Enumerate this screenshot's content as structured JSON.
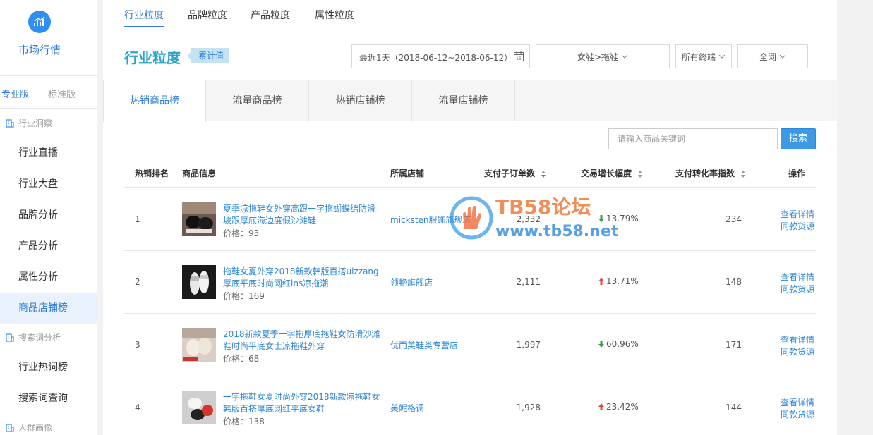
{
  "sidebar": {
    "app_title": "市场行情",
    "version_pro": "专业版",
    "version_std": "标准版",
    "groups": [
      "行业洞察",
      "搜索词分析",
      "人群画像"
    ],
    "items": [
      "行业直播",
      "行业大盘",
      "品牌分析",
      "产品分析",
      "属性分析",
      "商品店铺榜",
      "行业热词榜",
      "搜索词查询"
    ]
  },
  "top_tabs": [
    "行业粒度",
    "品牌粒度",
    "产品粒度",
    "属性粒度"
  ],
  "section": {
    "title": "行业粒度",
    "badge": "累计值"
  },
  "filters": {
    "date": "最近1天（2018-06-12~2018-06-12）",
    "calendar_day": "15",
    "category": "女鞋>拖鞋",
    "terminal": "所有终端",
    "network": "全网"
  },
  "rank_tabs": [
    "热销商品榜",
    "流量商品榜",
    "热销店铺榜",
    "流量店铺榜"
  ],
  "search": {
    "placeholder": "请输入商品关键词",
    "button": "搜索"
  },
  "table": {
    "headers": {
      "rank": "热销排名",
      "product": "商品信息",
      "shop": "所属店铺",
      "orders": "支付子订单数",
      "growth": "交易增长幅度",
      "conversion": "支付转化率指数",
      "action": "操作"
    },
    "rows": [
      {
        "rank": "1",
        "title": "夏季凉拖鞋女外穿高跟一字拖蝴蝶结防滑坡跟厚底海边度假沙滩鞋",
        "price": "价格：93",
        "shop": "micksten服饰旗舰店",
        "orders": "2,332",
        "growth": "13.79%",
        "growth_dir": "down",
        "conv": "234"
      },
      {
        "rank": "2",
        "title": "拖鞋女夏外穿2018新款韩版百搭ulzzang厚底平底时尚网红ins凉拖潮",
        "price": "价格：169",
        "shop": "领艳旗舰店",
        "orders": "2,111",
        "growth": "13.71%",
        "growth_dir": "up",
        "conv": "148"
      },
      {
        "rank": "3",
        "title": "2018新款夏季一字拖厚底拖鞋女防滑沙滩鞋时尚平底女士凉拖鞋外穿",
        "price": "价格：68",
        "shop": "优而美鞋类专营店",
        "orders": "1,997",
        "growth": "60.96%",
        "growth_dir": "down",
        "conv": "171"
      },
      {
        "rank": "4",
        "title": "一字拖鞋女夏时尚外穿2018新款凉拖鞋女韩版百搭厚底网红平底女鞋",
        "price": "价格：138",
        "shop": "芙妮格调",
        "orders": "1,928",
        "growth": "23.42%",
        "growth_dir": "up",
        "conv": "144"
      }
    ],
    "action_detail": "查看详情",
    "action_source": "同款货源"
  },
  "watermark": {
    "title": "TB58论坛",
    "url": "www.tb58.net"
  },
  "colors": {
    "accent": "#2f7bd8",
    "up": "#e8453c",
    "down": "#2e9e3f"
  }
}
